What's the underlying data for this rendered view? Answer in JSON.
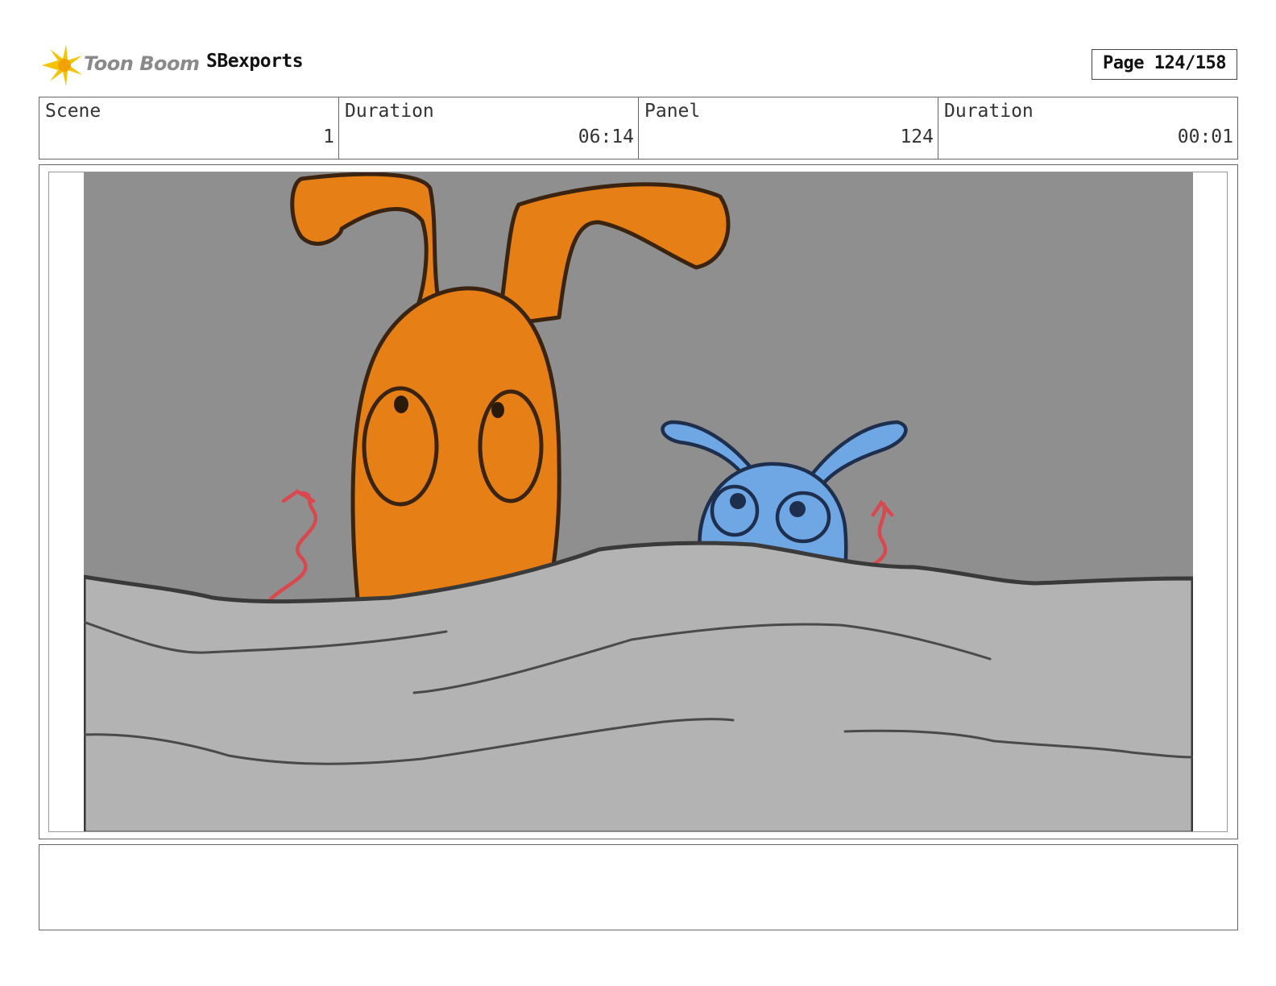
{
  "header": {
    "logo_text": "Toon Boom",
    "project_title": "SBexports",
    "page_label": "Page 124/158"
  },
  "info": {
    "scene_label": "Scene",
    "scene_value": "1",
    "scene_duration_label": "Duration",
    "scene_duration_value": "06:14",
    "panel_label": "Panel",
    "panel_value": "124",
    "panel_duration_label": "Duration",
    "panel_duration_value": "00:01"
  },
  "notes": {
    "text": ""
  },
  "colors": {
    "sky": "#8f8f8f",
    "ground": "#b3b3b3",
    "orange_character": "#e67f16",
    "blue_character": "#6fa6e4",
    "motion_arrows": "#d9474f",
    "logo_spark": "#f5c400"
  }
}
